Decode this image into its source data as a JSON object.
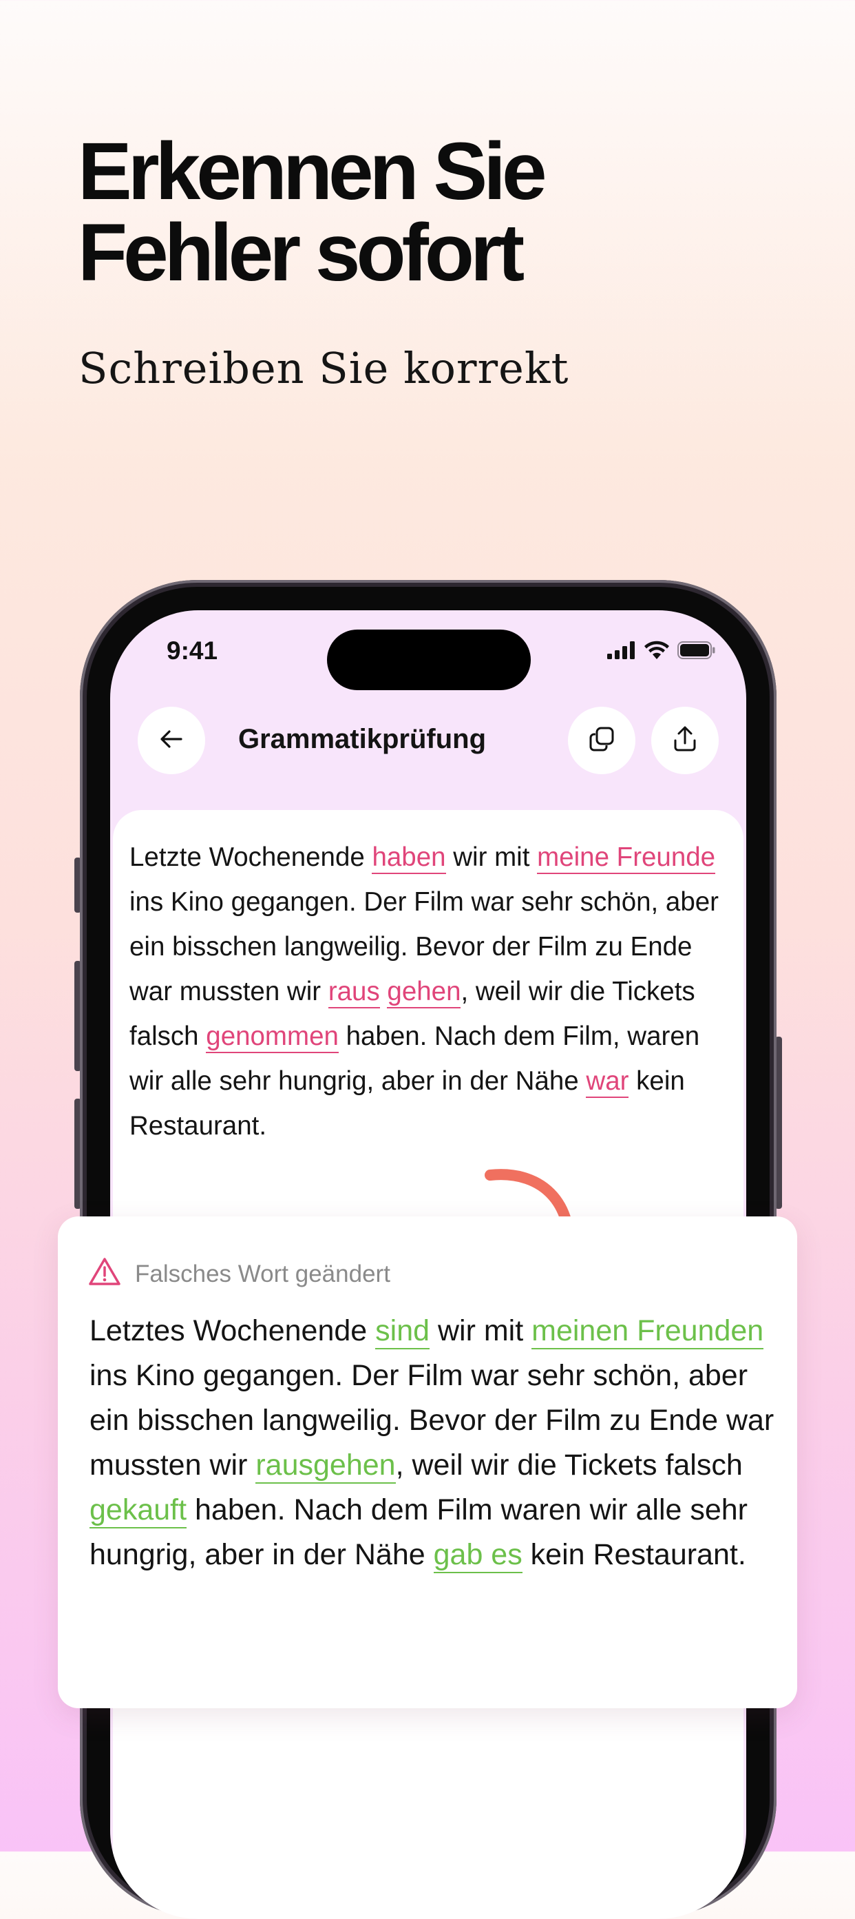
{
  "headline": {
    "line1": "Erkennen Sie",
    "line2": "Fehler sofort"
  },
  "subheadline": "Schreiben Sie korrekt",
  "status_bar": {
    "time": "9:41",
    "icons": [
      "cellular-signal-icon",
      "wifi-icon",
      "battery-icon"
    ]
  },
  "nav": {
    "title": "Grammatikprüfung",
    "back_icon": "arrow-left-icon",
    "copy_icon": "copy-icon",
    "share_icon": "share-upload-icon"
  },
  "original_text": {
    "segments": [
      {
        "text": "Letzte Wochenende "
      },
      {
        "text": "haben",
        "error": true
      },
      {
        "text": " wir mit "
      },
      {
        "text": "meine Freunde",
        "error": true
      },
      {
        "text": " ins Kino gegangen. Der Film war sehr schön, aber ein bisschen langweilig. Bevor der Film zu Ende war mussten wir "
      },
      {
        "text": "raus",
        "error": true
      },
      {
        "text": " "
      },
      {
        "text": "gehen",
        "error": true
      },
      {
        "text": ", weil wir die Tickets falsch "
      },
      {
        "text": "genommen",
        "error": true
      },
      {
        "text": " haben. Nach dem Film, waren wir alle sehr hungrig, aber in der Nähe "
      },
      {
        "text": "war",
        "error": true
      },
      {
        "text": " kein Restaurant."
      }
    ]
  },
  "correction": {
    "label": "Falsches Wort geändert",
    "icon": "warning-triangle-icon",
    "segments": [
      {
        "text": "Letztes Wochenende "
      },
      {
        "text": "sind",
        "fix": true
      },
      {
        "text": " wir mit "
      },
      {
        "text": "meinen Freunden",
        "fix": true
      },
      {
        "text": " ins Kino gegangen. Der Film war sehr schön, aber ein bisschen langweilig. Bevor der Film zu Ende war mussten wir "
      },
      {
        "text": "rausgehen",
        "fix": true
      },
      {
        "text": ", weil wir die Tickets falsch "
      },
      {
        "text": "gekauft",
        "fix": true
      },
      {
        "text": " haben. Nach dem Film waren wir alle sehr hungrig, aber in der Nähe "
      },
      {
        "text": "gab es",
        "fix": true
      },
      {
        "text": " kein Restaurant."
      }
    ]
  },
  "colors": {
    "error": "#e0457a",
    "fix": "#6cc04a",
    "arrow": "#f0705f",
    "screen_bg": "#f8e5fb"
  }
}
